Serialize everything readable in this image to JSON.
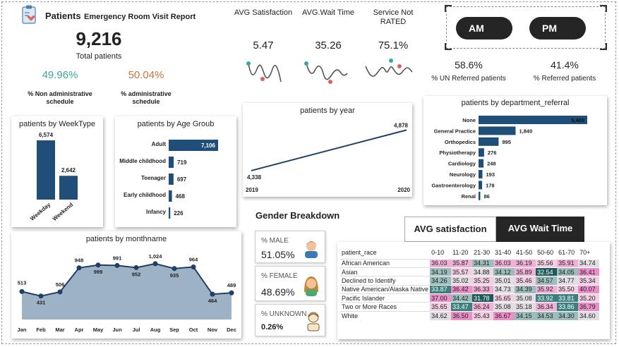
{
  "header": {
    "title": "Patients",
    "subtitle": "Emergency Room Visit Report"
  },
  "total": {
    "value": "9,216",
    "label": "Total patients"
  },
  "admin": {
    "non_admin_value": "49.96%",
    "non_admin_label": "% Non administrative schedule",
    "admin_value": "50.04%",
    "admin_label": "% administrative schedule",
    "non_admin_color": "#3aa7a0",
    "admin_color": "#c9743a"
  },
  "kpis": [
    {
      "label": "AVG Satisfaction",
      "value": "5.47"
    },
    {
      "label": "AVG.Wait Time",
      "value": "35.26"
    },
    {
      "label": "Service Not RATED",
      "value": "75.1%"
    }
  ],
  "buttons": {
    "am": "AM",
    "pm": "PM"
  },
  "referral": {
    "un_value": "58.6%",
    "un_label": "% UN Referred patients",
    "ref_value": "41.4%",
    "ref_label": "% Referred patients"
  },
  "weektype": {
    "title": "patients by WeekType",
    "categories": [
      "Weekday",
      "Weekend"
    ],
    "values": [
      6574,
      2642
    ],
    "labels": [
      "6,574",
      "2,642"
    ]
  },
  "agegroup": {
    "title": "patients by Age Groub",
    "categories": [
      "Adult",
      "Middle childhood",
      "Teenager",
      "Early childhood",
      "Infancy"
    ],
    "values": [
      7106,
      719,
      697,
      468,
      226
    ],
    "labels": [
      "7,106",
      "719",
      "697",
      "468",
      "226"
    ]
  },
  "year": {
    "title": "patients by year",
    "x": [
      "2019",
      "2020"
    ],
    "values": [
      4338,
      4878
    ],
    "labels": [
      "4,338",
      "4,878"
    ]
  },
  "department": {
    "title": "patients by department_referral",
    "categories": [
      "None",
      "General Practice",
      "Orthopedics",
      "Physiotherapy",
      "Cardiology",
      "Neurology",
      "Gastroenterology",
      "Renal"
    ],
    "values": [
      5400,
      1840,
      995,
      276,
      248,
      193,
      178,
      86
    ],
    "labels": [
      "5,400",
      "1,840",
      "995",
      "276",
      "248",
      "193",
      "178",
      "86"
    ]
  },
  "month": {
    "title": "patients by monthname",
    "categories": [
      "Jan",
      "Feb",
      "Mar",
      "Apr",
      "May",
      "Jun",
      "Jul",
      "Aug",
      "Sep",
      "Oct",
      "Nov",
      "Dec"
    ],
    "values": [
      513,
      431,
      506,
      948,
      999,
      991,
      952,
      1024,
      935,
      964,
      464,
      489
    ],
    "labels": [
      "513",
      "431",
      "506",
      "948",
      "999",
      "991",
      "952",
      "1,024",
      "935",
      "964",
      "464",
      "489"
    ]
  },
  "gender": {
    "title": "Gender Breakdown",
    "items": [
      {
        "label": "% MALE",
        "value": "51.05%"
      },
      {
        "label": "% FEMALE",
        "value": "48.69%"
      },
      {
        "label": "% UNKNOWN",
        "value": "0.26%"
      }
    ]
  },
  "tabs": {
    "satisfaction": "AVG satisfaction",
    "wait": "AVG Wait Time"
  },
  "heatmap": {
    "corner": "patient_race",
    "columns": [
      "0-10",
      "11-20",
      "21-30",
      "31-40",
      "41-50",
      "50-60",
      "61-70",
      "70+"
    ],
    "rows": [
      {
        "name": "African American",
        "values": [
          "36.03",
          "35.87",
          "34.31",
          "36.03",
          "36.19",
          "35.56",
          "35.91",
          "34.74"
        ]
      },
      {
        "name": "Asian",
        "values": [
          "34.19",
          "35.57",
          "34.88",
          "34.12",
          "35.89",
          "32.54",
          "34.05",
          "36.41"
        ]
      },
      {
        "name": "Declined to Identify",
        "values": [
          "34.26",
          "35.02",
          "35.25",
          "35.01",
          "35.46",
          "34.57",
          "34.77",
          "35.34"
        ]
      },
      {
        "name": "Native American/Alaska Native",
        "values": [
          "33.87",
          "36.42",
          "36.33",
          "34.73",
          "34.39",
          "35.92",
          "35.50",
          "40.07"
        ]
      },
      {
        "name": "Pacific Islander",
        "values": [
          "37.00",
          "34.42",
          "31.78",
          "35.65",
          "35.08",
          "33.92",
          "33.81",
          "35.20"
        ]
      },
      {
        "name": "Two or More Races",
        "values": [
          "35.65",
          "33.47",
          "36.24",
          "35.08",
          "35.18",
          "36.34",
          "33.86",
          "36.79"
        ]
      },
      {
        "name": "White",
        "values": [
          "34.62",
          "36.50",
          "35.43",
          "36.67",
          "34.15",
          "34.53",
          "34.30",
          "34.60"
        ]
      }
    ]
  },
  "colors": {
    "bar": "#1f4e79",
    "area": "#8da4bc",
    "line": "#1f3f66",
    "spark": "#555555",
    "spark_start": "#3aa7a0",
    "spark_end": "#e0605a"
  }
}
